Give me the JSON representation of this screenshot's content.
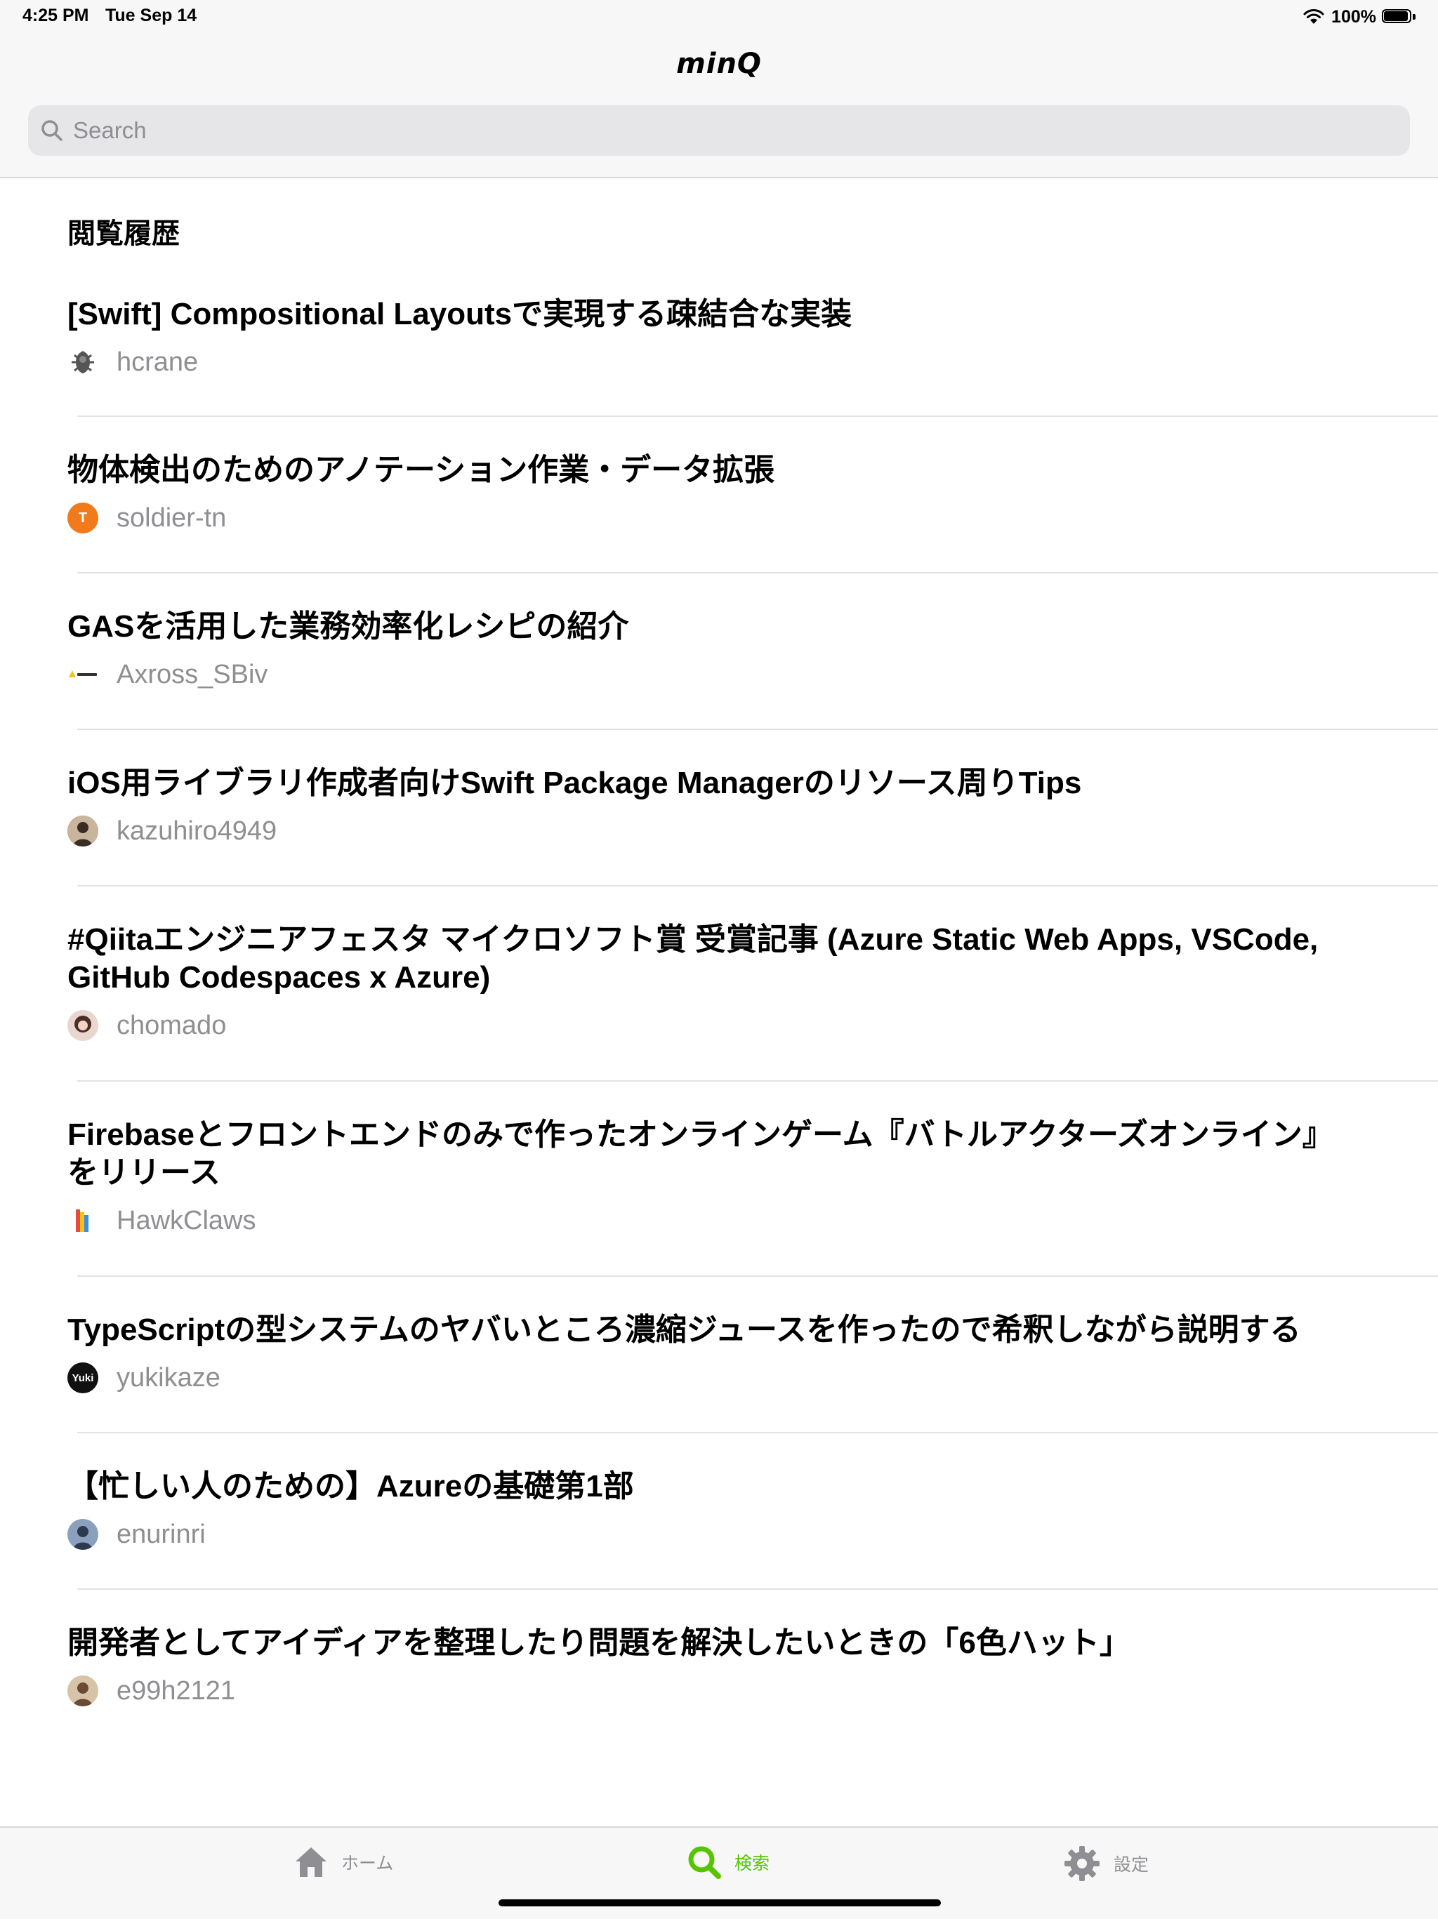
{
  "status_bar": {
    "time": "4:25 PM",
    "date": "Tue Sep 14",
    "battery": "100%"
  },
  "header": {
    "app_title": "minQ",
    "search_placeholder": "Search"
  },
  "history": {
    "title": "閲覧履歴",
    "items": [
      {
        "title": "[Swift] Compositional Layoutsで実現する疎結合な実装",
        "author": "hcrane",
        "avatar_color": "#5a5a5a",
        "avatar_text": ""
      },
      {
        "title": "物体検出のためのアノテーション作業・データ拡張",
        "author": "soldier-tn",
        "avatar_color": "#f07a1c",
        "avatar_text": "T"
      },
      {
        "title": "GASを活用した業務効率化レシピの紹介",
        "author": "Axross_SBiv",
        "avatar_color": "#f3c21b",
        "avatar_text": ""
      },
      {
        "title": "iOS用ライブラリ作成者向けSwift Package Managerのリソース周りTips",
        "author": "kazuhiro4949",
        "avatar_color": "#6d5a4c",
        "avatar_text": ""
      },
      {
        "title": "#Qiitaエンジニアフェスタ マイクロソフト賞 受賞記事 (Azure Static Web Apps, VSCode, GitHub Codespaces x Azure)",
        "author": "chomado",
        "avatar_color": "#8b5e52",
        "avatar_text": ""
      },
      {
        "title": "Firebaseとフロントエンドのみで作ったオンラインゲーム『バトルアクターズオンライン』をリリース",
        "author": "HawkClaws",
        "avatar_color": "#e9a33b",
        "avatar_text": ""
      },
      {
        "title": "TypeScriptの型システムのヤバいところ濃縮ジュースを作ったので希釈しながら説明する",
        "author": "yukikaze",
        "avatar_color": "#111111",
        "avatar_text": "Yuki"
      },
      {
        "title": "【忙しい人のための】Azureの基礎第1部",
        "author": "enurinri",
        "avatar_color": "#5b6d86",
        "avatar_text": ""
      },
      {
        "title": "開発者としてアイディアを整理したり問題を解決したいときの「6色ハット」",
        "author": "e99h2121",
        "avatar_color": "#a27655",
        "avatar_text": ""
      }
    ]
  },
  "tabbar": {
    "tabs": [
      {
        "label": "ホーム",
        "icon": "home-icon",
        "active": false
      },
      {
        "label": "検索",
        "icon": "search-icon",
        "active": true
      },
      {
        "label": "設定",
        "icon": "gear-icon",
        "active": false
      }
    ],
    "accent_color": "#55c500",
    "inactive_color": "#8e8e93"
  }
}
